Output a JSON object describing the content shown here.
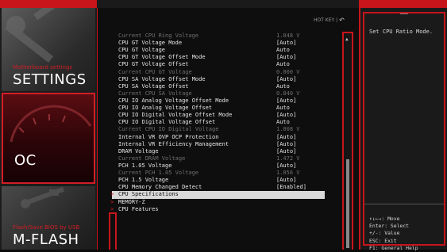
{
  "header": {
    "hotkey_label": "HOT KEY",
    "separator": "|",
    "back_icon": "↶"
  },
  "nav": {
    "settings": {
      "subtitle": "Motherboard settings",
      "title": "SETTINGS"
    },
    "oc": {
      "title": "OC"
    },
    "mflash": {
      "subtitle": "Flash/Save BIOS by USB",
      "title": "M-FLASH"
    }
  },
  "rows": [
    {
      "label": "Current CPU Ring Voltage",
      "value": "1.048 V",
      "style": "d"
    },
    {
      "label": "CPU GT Voltage Mode",
      "value": "[Auto]",
      "style": "w"
    },
    {
      "label": "CPU GT Voltage",
      "value": "Auto",
      "style": "w"
    },
    {
      "label": "CPU GT Voltage Offset Mode",
      "value": "[Auto]",
      "style": "w"
    },
    {
      "label": "CPU GT Voltage Offset",
      "value": "Auto",
      "style": "w"
    },
    {
      "label": "Current CPU GT Voltage",
      "value": "0.000 V",
      "style": "d"
    },
    {
      "label": "CPU SA Voltage Offset Mode",
      "value": "[Auto]",
      "style": "w"
    },
    {
      "label": "CPU SA Voltage Offset",
      "value": "Auto",
      "style": "w"
    },
    {
      "label": "Current CPU SA Voltage",
      "value": "0.840 V",
      "style": "d"
    },
    {
      "label": "CPU IO Analog Voltage Offset Mode",
      "value": "[Auto]",
      "style": "w"
    },
    {
      "label": "CPU IO Analog Voltage Offset",
      "value": "Auto",
      "style": "w"
    },
    {
      "label": "CPU IO Digital Voltage Offset Mode",
      "value": "[Auto]",
      "style": "w"
    },
    {
      "label": "CPU IO Digital Voltage Offset",
      "value": "Auto",
      "style": "w"
    },
    {
      "label": "Current CPU IO Digital Voltage",
      "value": "1.008 V",
      "style": "d"
    },
    {
      "label": "Internal VR OVP OCP Protection",
      "value": "[Auto]",
      "style": "w"
    },
    {
      "label": "Internal VR Efficiency Management",
      "value": "[Auto]",
      "style": "w"
    },
    {
      "label": "DRAM Voltage",
      "value": "[Auto]",
      "style": "w"
    },
    {
      "label": "Current DRAM Voltage",
      "value": "1.472 V",
      "style": "d"
    },
    {
      "label": "PCH 1.05 Voltage",
      "value": "[Auto]",
      "style": "w"
    },
    {
      "label": "Current PCH 1.05 Voltage",
      "value": "1.056 V",
      "style": "d"
    },
    {
      "label": "PCH 1.5 Voltage",
      "value": "[Auto]",
      "style": "w"
    },
    {
      "label": "CPU Memory Changed Detect",
      "value": "[Enabled]",
      "style": "w"
    },
    {
      "label": "CPU Specifications",
      "value": "",
      "style": "hl",
      "submenu": true
    },
    {
      "label": "MEMORY-Z",
      "value": "",
      "style": "w",
      "submenu": true
    },
    {
      "label": "CPU Features",
      "value": "",
      "style": "w",
      "submenu": true
    }
  ],
  "submenu_arrow": ">",
  "scrollbar": {
    "up_icon": "▲"
  },
  "help": {
    "description": "Set CPU Ratio Mode.",
    "keys": [
      "↑↓←→: Move",
      "Enter: Select",
      "+/-: Value",
      "ESC: Exit",
      "F1: General Help"
    ]
  }
}
